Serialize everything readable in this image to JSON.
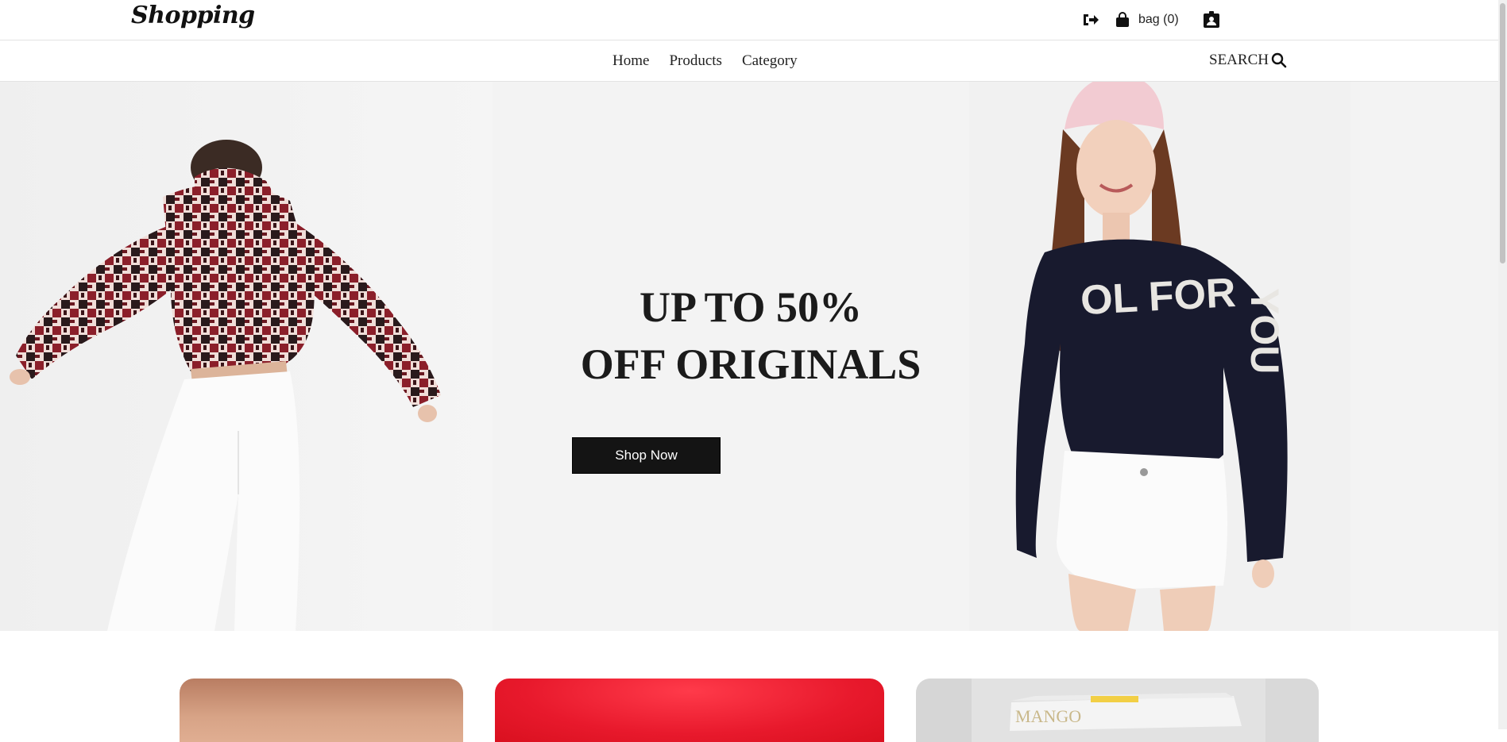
{
  "header": {
    "logo": "Shopping",
    "icons": [
      "sign-out-icon",
      "shopping-bag-icon",
      "user-badge-icon"
    ],
    "bag_label": "bag (0)"
  },
  "nav": {
    "links": [
      "Home",
      "Products",
      "Category"
    ],
    "search_label": "SEARCH"
  },
  "hero": {
    "headline_line1": "UP TO 50%",
    "headline_line2": "OFF ORIGINALS",
    "cta_label": "Shop Now"
  },
  "colors": {
    "accent_dark": "#141414",
    "hero_bg": "#f3f3f3",
    "card_red": "#e8192c",
    "card_tan": "#c98f73",
    "card_grey": "#e2e2e2"
  }
}
